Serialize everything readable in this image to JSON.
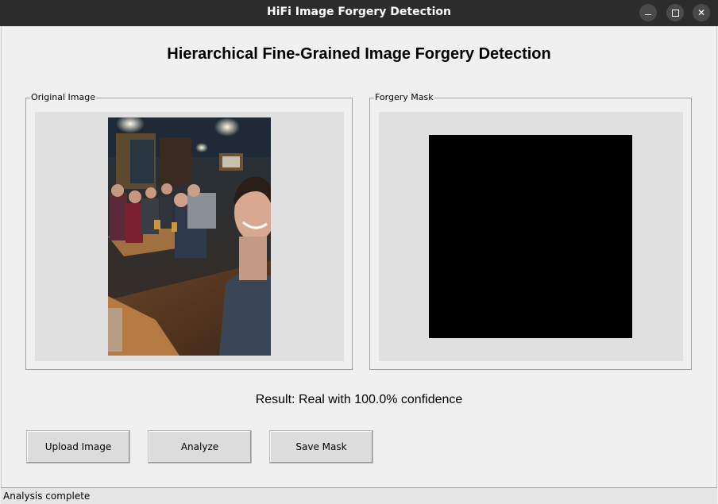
{
  "window": {
    "title": "HiFi Image Forgery Detection",
    "controls": [
      "minimize-icon",
      "maximize-icon",
      "close-icon"
    ]
  },
  "main": {
    "heading": "Hierarchical Fine-Grained Image Forgery Detection",
    "original_group_label": "Original Image",
    "mask_group_label": "Forgery Mask",
    "result_text": "Result: Real with 100.0% confidence"
  },
  "buttons": {
    "upload_label": "Upload Image",
    "analyze_label": "Analyze",
    "save_label": "Save Mask"
  },
  "status": {
    "text": "Analysis complete"
  },
  "colors": {
    "titlebar": "#2c2c2c",
    "window_bg": "#f0f0f0",
    "panel_bg": "#e0e0e0",
    "mask": "#000000"
  }
}
